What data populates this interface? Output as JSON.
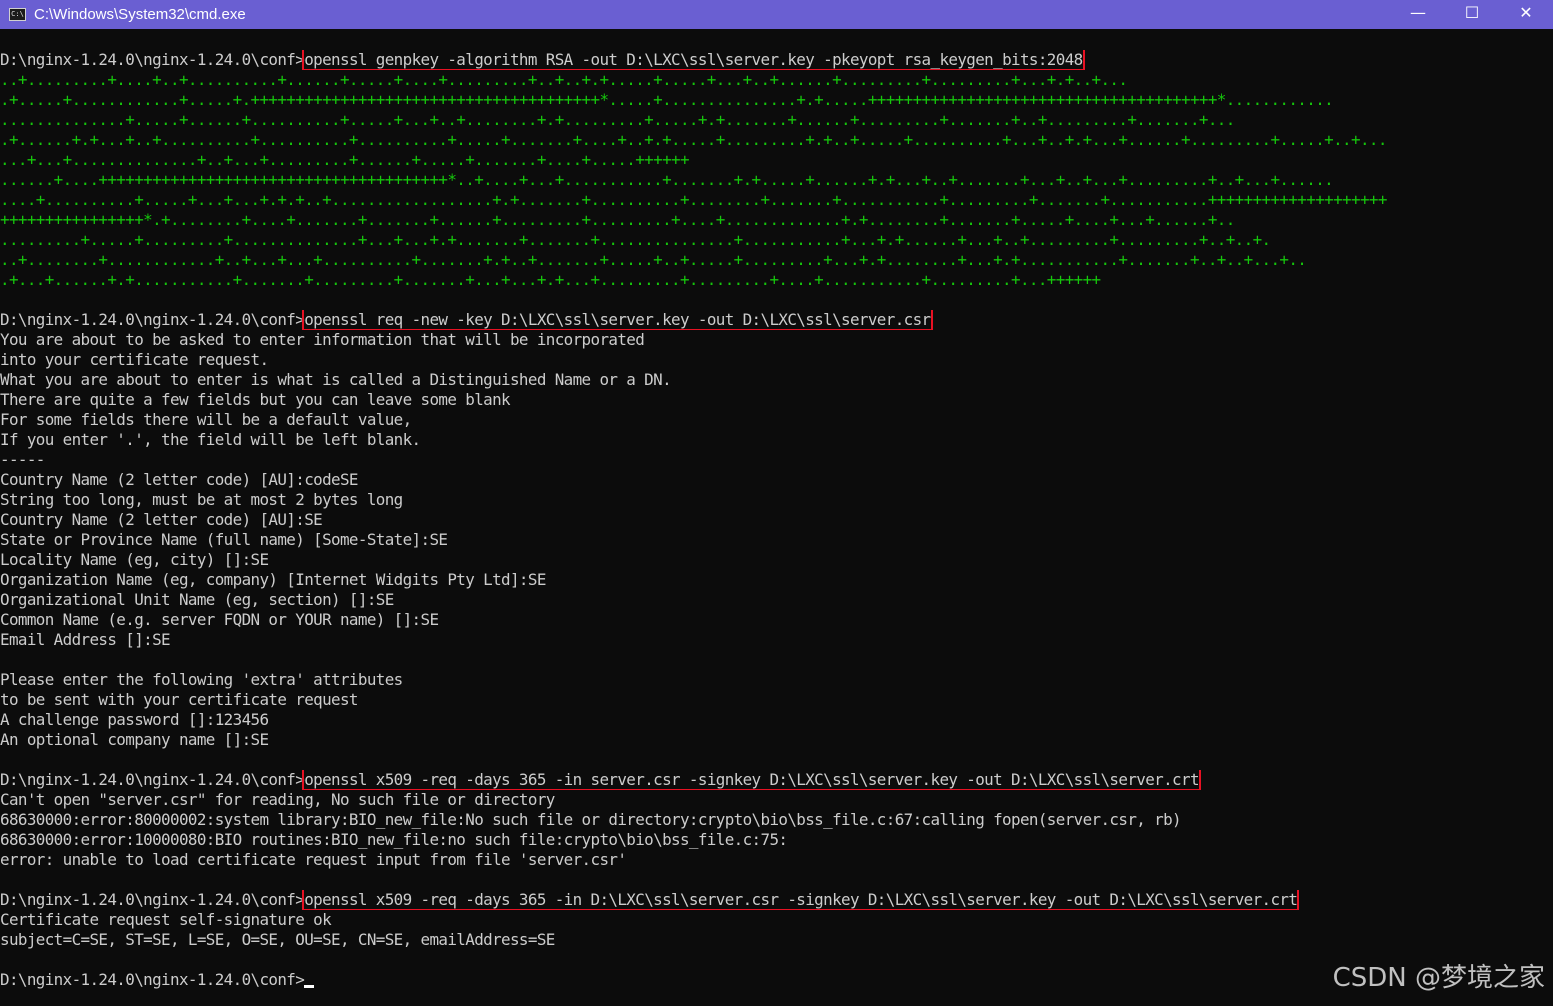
{
  "window": {
    "title": "C:\\Windows\\System32\\cmd.exe",
    "icon_text": "C:\\",
    "minimize_glyph": "—",
    "maximize_glyph": "☐",
    "close_glyph": "✕"
  },
  "prompt": "D:\\nginx-1.24.0\\nginx-1.24.0\\conf>",
  "commands": {
    "genkey": "openssl genpkey -algorithm RSA -out D:\\LXC\\ssl\\server.key -pkeyopt rsa_keygen_bits:2048",
    "req": "openssl req -new -key D:\\LXC\\ssl\\server.key -out D:\\LXC\\ssl\\server.csr",
    "x509_fail": "openssl x509 -req -days 365 -in server.csr -signkey D:\\LXC\\ssl\\server.key -out D:\\LXC\\ssl\\server.crt",
    "x509_ok": "openssl x509 -req -days 365 -in D:\\LXC\\ssl\\server.csr -signkey D:\\LXC\\ssl\\server.key -out D:\\LXC\\ssl\\server.crt"
  },
  "keygen_progress": [
    "..+.........+....+..+..........+......+.....+....+.........+..+..+.+.....+.....+...+..+......+.........+.........+...+.+..+...",
    ".+.....+............+.....+.+++++++++++++++++++++++++++++++++++++++*.....+...............+.+.....+++++++++++++++++++++++++++++++++++++++*............",
    "..............+.....+......+..........+.....+...+..+........+.+.........+.....+.+.......+......+.........+.......+..+.........+.......+...",
    ".+......+.+...+..+..........+..........+..........+.....+.......+....+..+.+.....+.........+.+..+.....+..........+...+..+.+...+......+.........+.....+..+...",
    "...+...+..............+..+...+.........+......+.....+.......+....+.....++++++",
    "......+....+++++++++++++++++++++++++++++++++++++++*..+....+...+...........+.......+.+.....+......+.+...+..+.......+...+..+...+.........+..+...+......",
    "....+..........+.....+...+...+.+.+..+..................+.+.......+..........+........+.......+...........+.........+.......+...........++++++++++++++++++++",
    "++++++++++++++++*.+........+....+.......+.......+......+.........+.........+....+.............+.+........+.......+.....+....+...+......+..",
    ".........+.....+.........+..............+...+...+.+.......+.......+...............+...........+...+.+......+...+..+.........+.........+..+..+.",
    "..+........+............+..+...+...+..........+.......+.+..+.......+.....+..+.....+.........+...+.+........+...+.+...........+.......+..+..+...+..",
    ".+...+......+.+...........+.......+.........+.......+...+...+.+...+.........+.........+....+...........+.........+...++++++"
  ],
  "req_output": [
    "You are about to be asked to enter information that will be incorporated",
    "into your certificate request.",
    "What you are about to enter is what is called a Distinguished Name or a DN.",
    "There are quite a few fields but you can leave some blank",
    "For some fields there will be a default value,",
    "If you enter '.', the field will be left blank.",
    "-----",
    "Country Name (2 letter code) [AU]:codeSE",
    "String too long, must be at most 2 bytes long",
    "Country Name (2 letter code) [AU]:SE",
    "State or Province Name (full name) [Some-State]:SE",
    "Locality Name (eg, city) []:SE",
    "Organization Name (eg, company) [Internet Widgits Pty Ltd]:SE",
    "Organizational Unit Name (eg, section) []:SE",
    "Common Name (e.g. server FQDN or YOUR name) []:SE",
    "Email Address []:SE",
    "",
    "Please enter the following 'extra' attributes",
    "to be sent with your certificate request",
    "A challenge password []:123456",
    "An optional company name []:SE"
  ],
  "x509_fail_output": [
    "Can't open \"server.csr\" for reading, No such file or directory",
    "68630000:error:80000002:system library:BIO_new_file:No such file or directory:crypto\\bio\\bss_file.c:67:calling fopen(server.csr, rb)",
    "68630000:error:10000080:BIO routines:BIO_new_file:no such file:crypto\\bio\\bss_file.c:75:",
    "error: unable to load certificate request input from file 'server.csr'"
  ],
  "x509_ok_output": [
    "Certificate request self-signature ok",
    "subject=C=SE, ST=SE, L=SE, O=SE, OU=SE, CN=SE, emailAddress=SE"
  ],
  "watermark": "CSDN @梦境之家",
  "colors": {
    "titlebar": "#6a5fd2",
    "console_bg": "#0c0c0c",
    "console_text": "#cccccc",
    "progress_green": "#16c60c",
    "highlight_box": "#e81123"
  }
}
